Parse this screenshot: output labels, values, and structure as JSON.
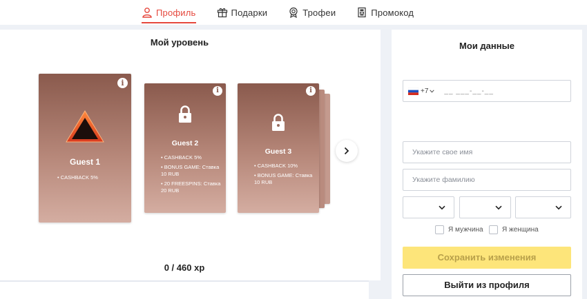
{
  "tabs": [
    {
      "label": "Профиль",
      "icon": "user-icon",
      "active": true
    },
    {
      "label": "Подарки",
      "icon": "gift-icon",
      "active": false
    },
    {
      "label": "Трофеи",
      "icon": "medal-icon",
      "active": false
    },
    {
      "label": "Промокод",
      "icon": "promo-icon",
      "active": false
    }
  ],
  "level": {
    "title": "Мой уровень",
    "xp": "0 / 460 xp",
    "cards": [
      {
        "name": "Guest 1",
        "icon": "triangle-level-icon",
        "perks": [
          "CASHBACK 5%"
        ]
      },
      {
        "name": "Guest 2",
        "icon": "lock-icon",
        "perks": [
          "CASHBACK 5%",
          "BONUS GAME: Ставка 10 RUB",
          "20 FREESPINS: Ставка 20 RUB"
        ]
      },
      {
        "name": "Guest 3",
        "icon": "lock-icon",
        "perks": [
          "CASHBACK 10%",
          "BONUS GAME: Ставка 10 RUB"
        ]
      }
    ]
  },
  "profile": {
    "title": "Мои данные",
    "phone_code": "+7",
    "phone_mask": "__ ___-__-__",
    "first_name_placeholder": "Укажите свое имя",
    "last_name_placeholder": "Укажите фамилию",
    "male_label": "Я мужчина",
    "female_label": "Я женщина",
    "save_label": "Сохранить изменения",
    "logout_label": "Выйти из профиля"
  },
  "colors": {
    "accent": "#e5473c",
    "save_button": "#fde57a",
    "card_top": "#8a5a4d",
    "card_bottom": "#d4ada1"
  }
}
